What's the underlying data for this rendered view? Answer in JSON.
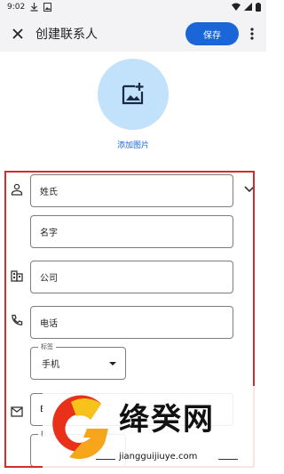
{
  "status_bar": {
    "time": "9:02"
  },
  "appbar": {
    "title": "创建联系人",
    "save_label": "保存"
  },
  "photo": {
    "add_label": "添加图片"
  },
  "form": {
    "surname_placeholder": "姓氏",
    "given_name_placeholder": "名字",
    "company_placeholder": "公司",
    "phone_placeholder": "电话",
    "phone_type_label": "标签",
    "phone_type_value": "手机",
    "email_placeholder": "E",
    "email_type_label": "标"
  },
  "watermark": {
    "brand": "绛癸网",
    "url": "jiangguijiuye.com"
  },
  "colors": {
    "accent": "#1a66d8",
    "photo_bg": "#c2e1fb",
    "highlight_border": "#d72b2b"
  }
}
